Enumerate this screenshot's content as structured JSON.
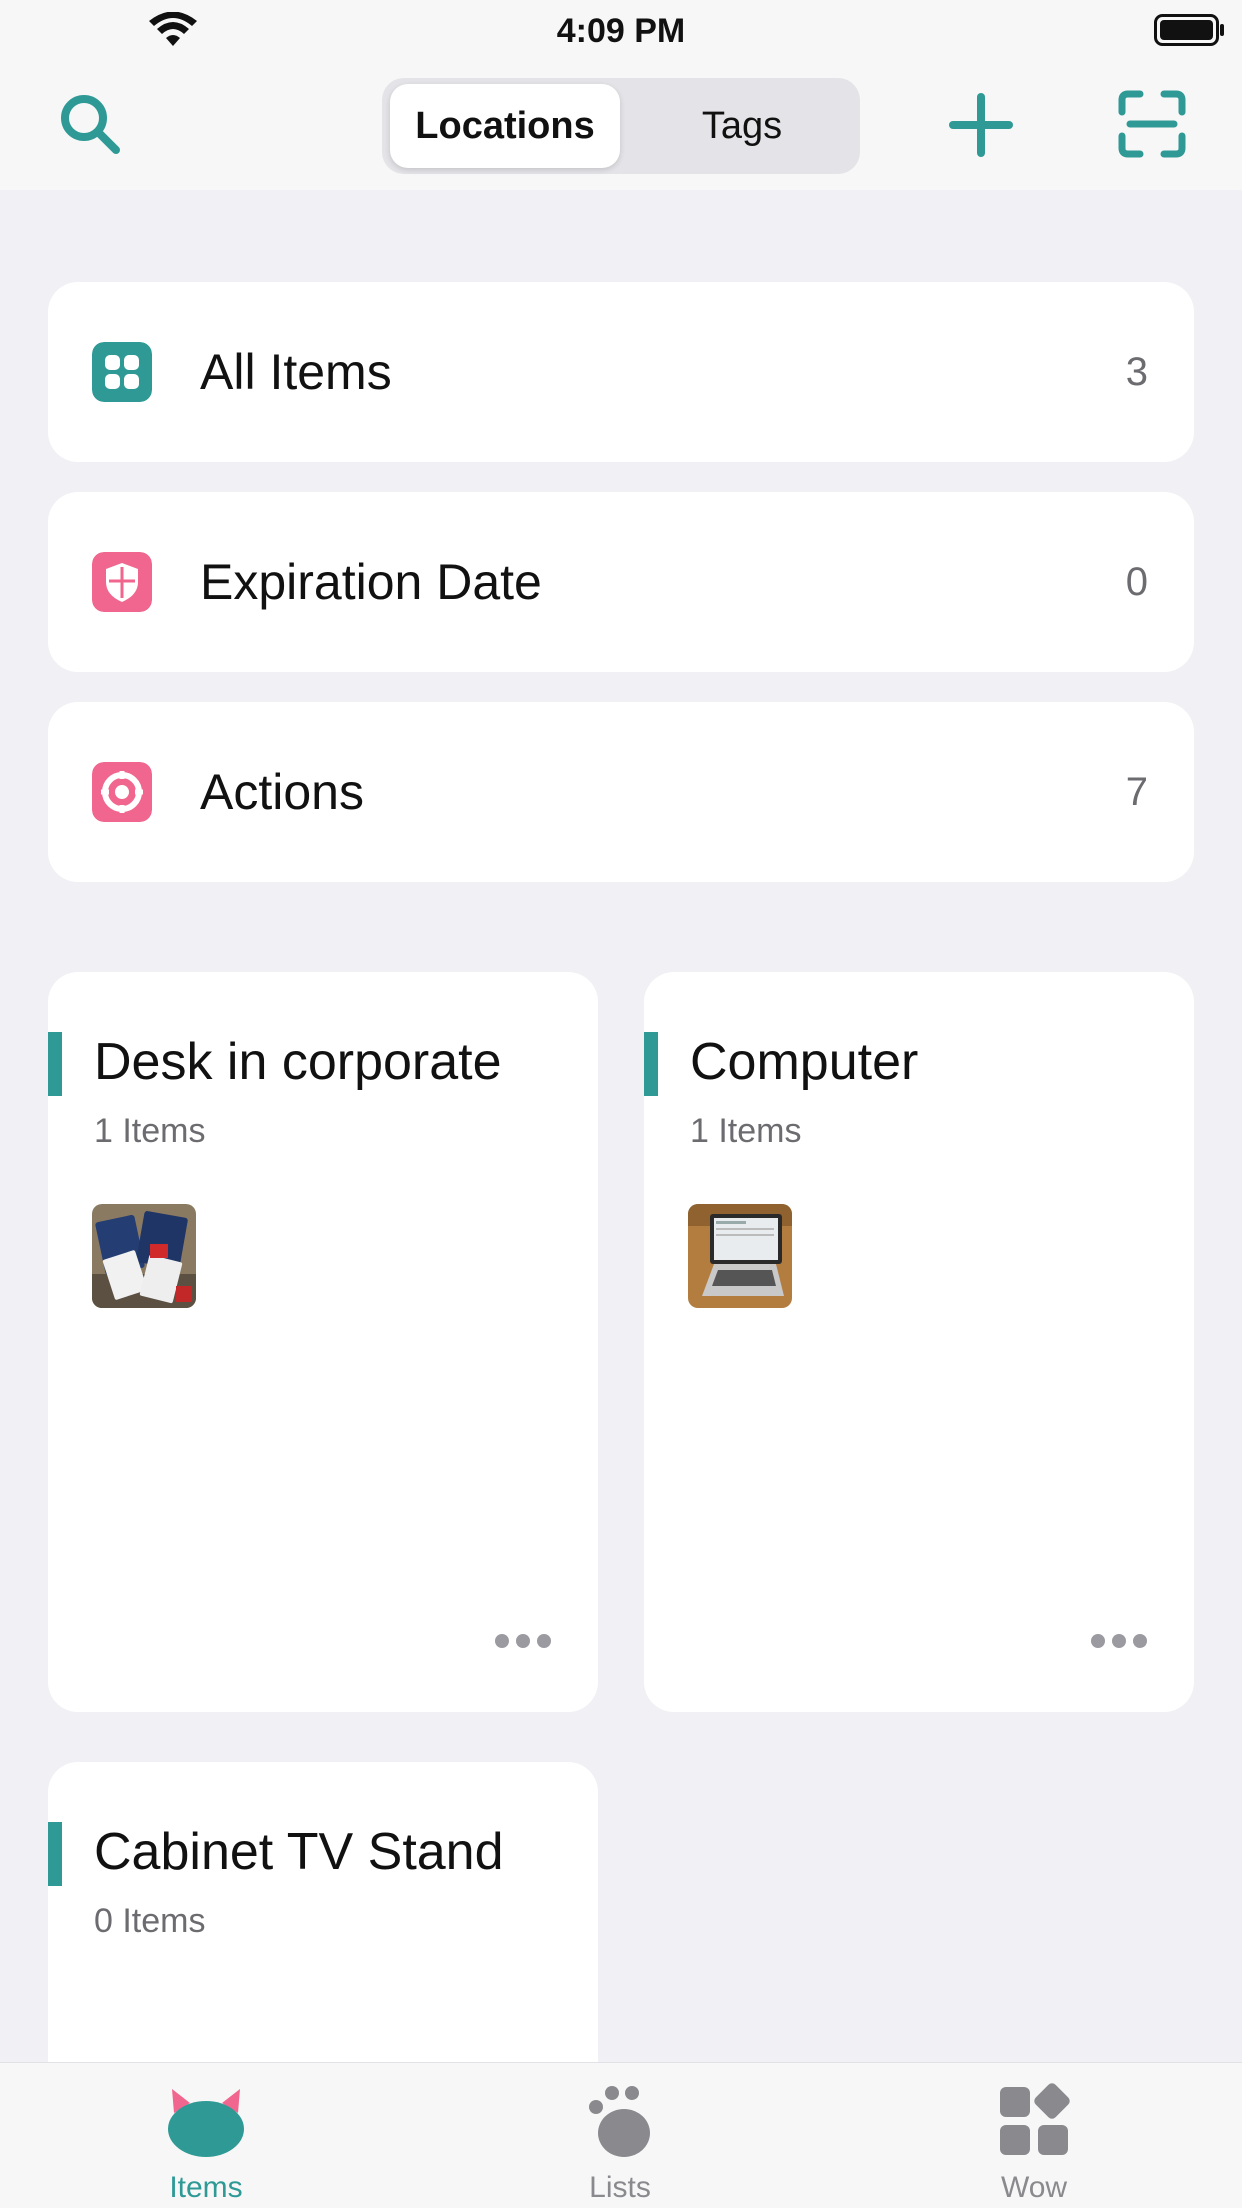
{
  "status_bar": {
    "time": "4:09 PM"
  },
  "nav": {
    "segments": [
      "Locations",
      "Tags"
    ],
    "active_segment": "Locations",
    "accent_color": "#2f9a95"
  },
  "summary": [
    {
      "label": "All Items",
      "count": "3",
      "icon": "grid-icon",
      "icon_color": "#2f9a95"
    },
    {
      "label": "Expiration Date",
      "count": "0",
      "icon": "shield-icon",
      "icon_color": "#f0668e"
    },
    {
      "label": "Actions",
      "count": "7",
      "icon": "target-icon",
      "icon_color": "#f0668e"
    }
  ],
  "locations": [
    {
      "name": "Desk in corporate",
      "count": "1 Items",
      "thumbnail": "desk-photo"
    },
    {
      "name": "Computer",
      "count": "1 Items",
      "thumbnail": "laptop-photo"
    },
    {
      "name": "Cabinet TV Stand",
      "count": "0 Items"
    }
  ],
  "tabs": [
    {
      "label": "Items",
      "icon": "cat-icon",
      "active": true
    },
    {
      "label": "Lists",
      "icon": "paw-icon",
      "active": false
    },
    {
      "label": "Wow",
      "icon": "widgets-icon",
      "active": false
    }
  ]
}
